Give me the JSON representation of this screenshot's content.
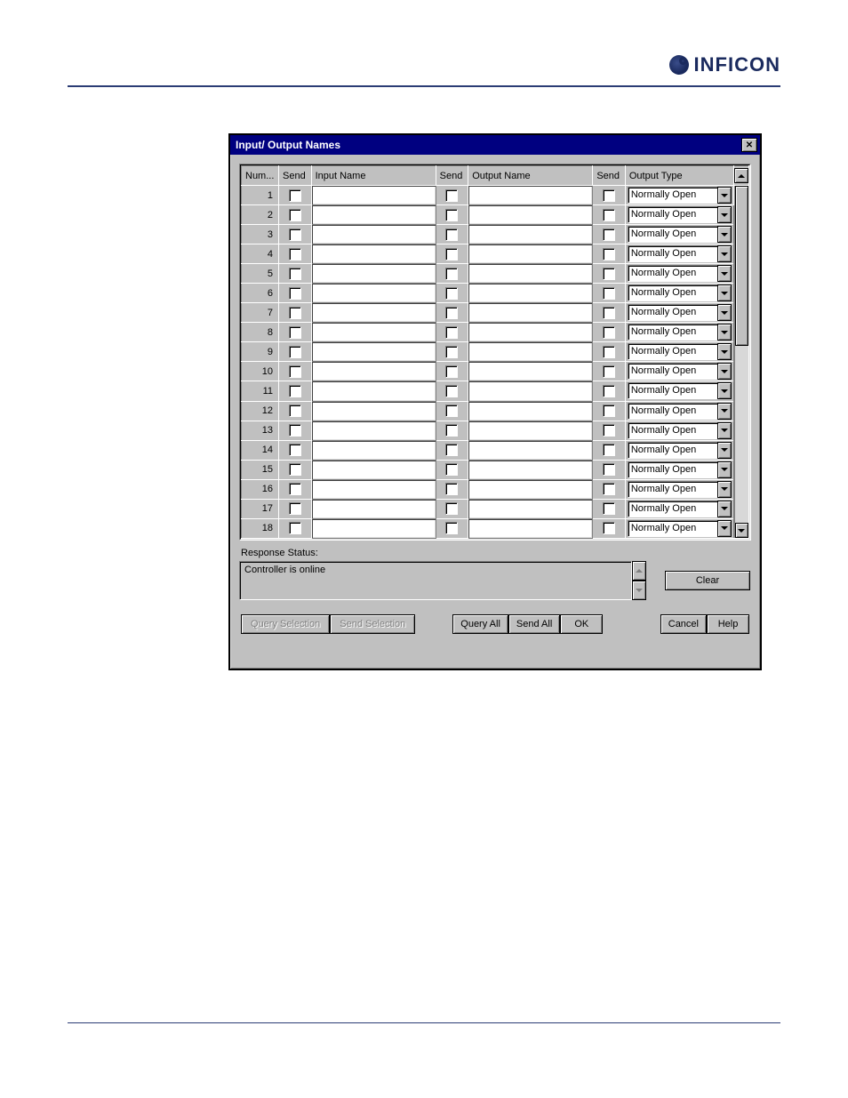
{
  "brand": "INFICON",
  "dialog": {
    "title": "Input/ Output Names",
    "columns": {
      "num": "Num...",
      "send1": "Send",
      "input_name": "Input Name",
      "send2": "Send",
      "output_name": "Output Name",
      "send3": "Send",
      "output_type": "Output Type"
    },
    "rows": [
      {
        "num": "1",
        "input_name": "",
        "output_name": "",
        "output_type": "Normally Open"
      },
      {
        "num": "2",
        "input_name": "",
        "output_name": "",
        "output_type": "Normally Open"
      },
      {
        "num": "3",
        "input_name": "",
        "output_name": "",
        "output_type": "Normally Open"
      },
      {
        "num": "4",
        "input_name": "",
        "output_name": "",
        "output_type": "Normally Open"
      },
      {
        "num": "5",
        "input_name": "",
        "output_name": "",
        "output_type": "Normally Open"
      },
      {
        "num": "6",
        "input_name": "",
        "output_name": "",
        "output_type": "Normally Open"
      },
      {
        "num": "7",
        "input_name": "",
        "output_name": "",
        "output_type": "Normally Open"
      },
      {
        "num": "8",
        "input_name": "",
        "output_name": "",
        "output_type": "Normally Open"
      },
      {
        "num": "9",
        "input_name": "",
        "output_name": "",
        "output_type": "Normally Open"
      },
      {
        "num": "10",
        "input_name": "",
        "output_name": "",
        "output_type": "Normally Open"
      },
      {
        "num": "11",
        "input_name": "",
        "output_name": "",
        "output_type": "Normally Open"
      },
      {
        "num": "12",
        "input_name": "",
        "output_name": "",
        "output_type": "Normally Open"
      },
      {
        "num": "13",
        "input_name": "",
        "output_name": "",
        "output_type": "Normally Open"
      },
      {
        "num": "14",
        "input_name": "",
        "output_name": "",
        "output_type": "Normally Open"
      },
      {
        "num": "15",
        "input_name": "",
        "output_name": "",
        "output_type": "Normally Open"
      },
      {
        "num": "16",
        "input_name": "",
        "output_name": "",
        "output_type": "Normally Open"
      },
      {
        "num": "17",
        "input_name": "",
        "output_name": "",
        "output_type": "Normally Open"
      },
      {
        "num": "18",
        "input_name": "",
        "output_name": "",
        "output_type": "Normally Open"
      }
    ],
    "response_status_label": "Response Status:",
    "response_status_text": "Controller is online",
    "buttons": {
      "clear": "Clear",
      "query_selection": "Query Selection",
      "send_selection": "Send Selection",
      "query_all": "Query All",
      "send_all": "Send All",
      "ok": "OK",
      "cancel": "Cancel",
      "help": "Help"
    }
  }
}
